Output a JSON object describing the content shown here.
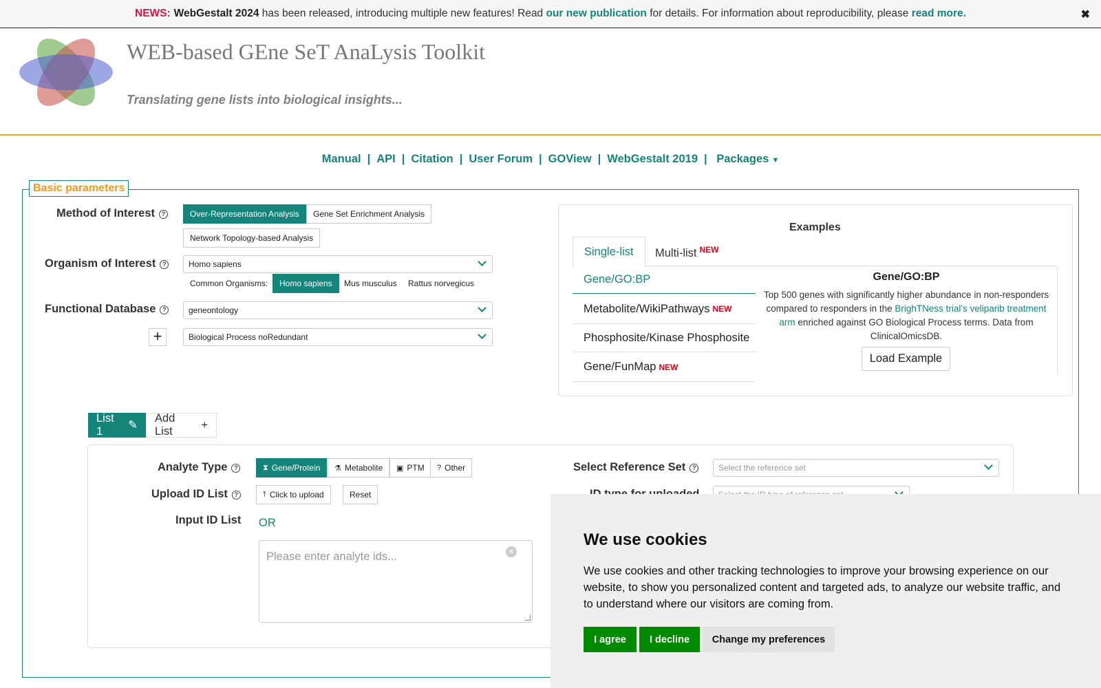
{
  "news": {
    "label": "NEWS:",
    "product": "WebGestalt 2024",
    "text1": " has been released, introducing multiple new features! Read ",
    "link1": "our new publication",
    "text2": " for details. For information about reproducibility, please ",
    "link2": "read more.",
    "close": "✖"
  },
  "header": {
    "title": "WEB-based GEne SeT AnaLysis Toolkit",
    "tagline": "Translating gene lists into biological insights..."
  },
  "nav": {
    "items": [
      "Manual",
      "API",
      "Citation",
      "User Forum",
      "GOView",
      "WebGestalt 2019",
      "Packages"
    ],
    "separator": "|",
    "caret": "▼"
  },
  "basic": {
    "legend": "Basic parameters",
    "method": {
      "label": "Method of Interest",
      "options": [
        "Over-Representation Analysis",
        "Gene Set Enrichment Analysis",
        "Network Topology-based Analysis"
      ],
      "selected": "Over-Representation Analysis"
    },
    "organism": {
      "label": "Organism of Interest",
      "value": "Homo sapiens",
      "common_label": "Common Organisms:",
      "common": [
        "Homo sapiens",
        "Mus musculus",
        "Rattus norvegicus"
      ]
    },
    "database": {
      "label": "Functional Database",
      "value": "geneontology",
      "sub_value": "Biological Process noRedundant",
      "add": "+"
    }
  },
  "examples": {
    "title": "Examples",
    "tabs": [
      {
        "label": "Single-list",
        "badge": ""
      },
      {
        "label": "Multi-list",
        "badge": "NEW"
      }
    ],
    "items": [
      {
        "label": "Gene/GO:BP",
        "badge": ""
      },
      {
        "label": "Metabolite/WikiPathways",
        "badge": "NEW"
      },
      {
        "label": "Phosphosite/Kinase Phosphosite",
        "badge": ""
      },
      {
        "label": "Gene/FunMap",
        "badge": "NEW"
      }
    ],
    "detail_title": "Gene/GO:BP",
    "detail_text1": "Top 500 genes with significantly higher abundance in non-responders compared to responders in the ",
    "detail_link": "BrighTNess trial's veliparib treatment arm",
    "detail_text2": " enriched against GO Biological Process terms. Data from ClinicalOmicsDB.",
    "load_button": "Load Example"
  },
  "lists": {
    "active_tab": "List 1",
    "edit_icon": "✎",
    "add_tab": "Add List",
    "add_icon": "+"
  },
  "analyte": {
    "label": "Analyte Type",
    "options": [
      {
        "label": "Gene/Protein",
        "icon": "⧗"
      },
      {
        "label": "Metabolite",
        "icon": "⚗"
      },
      {
        "label": "PTM",
        "icon": "▣"
      },
      {
        "label": "Other",
        "icon": "?"
      }
    ],
    "selected": "Gene/Protein"
  },
  "upload": {
    "label": "Upload ID List",
    "upload_icon": "⤒",
    "upload_button": "Click to upload",
    "reset_button": "Reset"
  },
  "input": {
    "label": "Input ID List",
    "or": "OR",
    "placeholder": "Please enter analyte ids...",
    "clear_icon": "×"
  },
  "reference": {
    "label": "Select Reference Set",
    "placeholder": "Select the reference set",
    "idtype_label": "ID type for uploaded",
    "idtype_placeholder": "Select the ID type of reference set"
  },
  "cookie": {
    "title": "We use cookies",
    "text": "We use cookies and other tracking technologies to improve your browsing experience on our website, to show you personalized content and targeted ads, to analyze our website traffic, and to understand where our visitors are coming from.",
    "agree": "I agree",
    "decline": "I decline",
    "preferences": "Change my preferences"
  },
  "colors": {
    "accent": "#15857c",
    "news_red": "#d7153f",
    "orange": "#f2a531",
    "badge_red": "#e0001b",
    "cookie_green": "#008a00"
  }
}
